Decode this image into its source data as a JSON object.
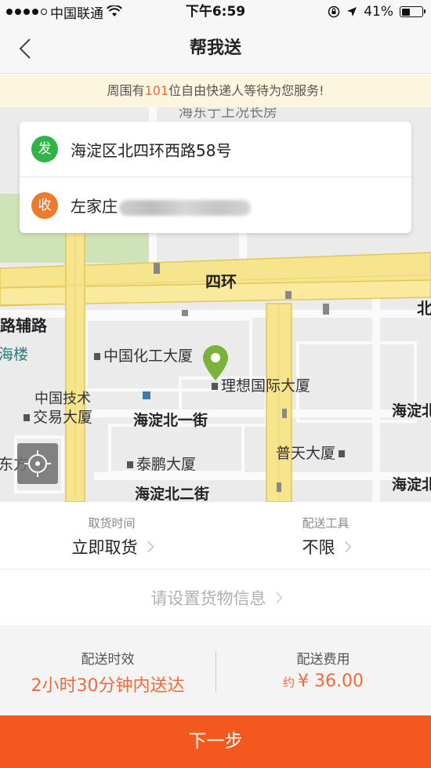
{
  "status_bar": {
    "carrier": "中国联通",
    "time": "下午6:59",
    "battery": "41%",
    "battery_level": 0.41,
    "signal_bars_filled": 4
  },
  "nav": {
    "title": "帮我送",
    "back_icon": "chevron-left-icon"
  },
  "notice": {
    "prefix": "周围有",
    "count": "101",
    "suffix": "位自由快递人等待为您服务!"
  },
  "addresses": {
    "sender": {
      "badge": "发",
      "text": "海淀区北四环西路58号",
      "color": "#31b34a"
    },
    "receiver": {
      "badge": "收",
      "text": "左家庄",
      "color": "#ee7a2d"
    }
  },
  "map": {
    "labels": {
      "top": "海东亍上况长房",
      "siring": "四环",
      "fulu": "路辅路",
      "hailou": "海楼",
      "bei": "北",
      "huagong": "中国化工大厦",
      "lixiang": "理想国际大厦",
      "jishu_line1": "中国技术",
      "jishu_line2": "交易大厦",
      "yijie": "海淀北一街",
      "haidian_bei_r1": "海淀北",
      "dongfang": "东方",
      "taipeng": "泰鹏大厦",
      "putian": "普天大厦",
      "erjie": "海淀北二街",
      "haidian_bei_r2": "海淀北"
    },
    "pin_color": "#7ab33a",
    "locate_icon": "crosshair-icon"
  },
  "options": {
    "pickup": {
      "label": "取货时间",
      "value": "立即取货"
    },
    "tool": {
      "label": "配送工具",
      "value": "不限"
    }
  },
  "goods": {
    "label": "请设置货物信息"
  },
  "summary": {
    "time": {
      "label": "配送时效",
      "value": "2小时30分钟内送达"
    },
    "fee": {
      "label": "配送费用",
      "approx": "约",
      "value": "¥ 36.00"
    }
  },
  "next_button": {
    "label": "下一步"
  },
  "colors": {
    "accent": "#f3581f",
    "highlight": "#f26a3c",
    "notice_bg": "#fbf6dd",
    "road": "#f6e58d"
  }
}
